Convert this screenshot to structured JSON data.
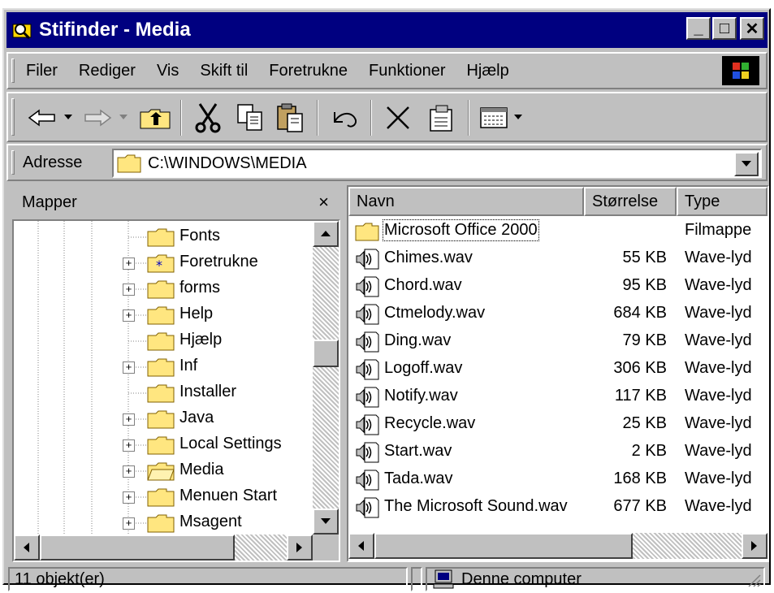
{
  "window": {
    "title": "Stifinder - Media",
    "minimize": "_",
    "maximize": "□",
    "close": "✕"
  },
  "menu": [
    "Filer",
    "Rediger",
    "Vis",
    "Skift til",
    "Foretrukne",
    "Funktioner",
    "Hjælp"
  ],
  "address": {
    "label": "Adresse",
    "value": "C:\\WINDOWS\\MEDIA"
  },
  "left_pane": {
    "title": "Mapper",
    "close": "×",
    "folders": [
      {
        "label": "Fonts",
        "expandable": false
      },
      {
        "label": "Foretrukne",
        "expandable": true
      },
      {
        "label": "forms",
        "expandable": true
      },
      {
        "label": "Help",
        "expandable": true
      },
      {
        "label": "Hjælp",
        "expandable": false
      },
      {
        "label": "Inf",
        "expandable": true
      },
      {
        "label": "Installer",
        "expandable": false
      },
      {
        "label": "Java",
        "expandable": true
      },
      {
        "label": "Local Settings",
        "expandable": true
      },
      {
        "label": "Media",
        "expandable": true
      },
      {
        "label": "Menuen Start",
        "expandable": true
      },
      {
        "label": "Msagent",
        "expandable": true
      }
    ]
  },
  "list": {
    "columns": {
      "name": "Navn",
      "size": "Størrelse",
      "type": "Type"
    },
    "items": [
      {
        "name": "Microsoft Office 2000",
        "size": "",
        "type": "Filmappe",
        "kind": "folder"
      },
      {
        "name": "Chimes.wav",
        "size": "55 KB",
        "type": "Wave-lyd",
        "kind": "wav"
      },
      {
        "name": "Chord.wav",
        "size": "95 KB",
        "type": "Wave-lyd",
        "kind": "wav"
      },
      {
        "name": "Ctmelody.wav",
        "size": "684 KB",
        "type": "Wave-lyd",
        "kind": "wav"
      },
      {
        "name": "Ding.wav",
        "size": "79 KB",
        "type": "Wave-lyd",
        "kind": "wav"
      },
      {
        "name": "Logoff.wav",
        "size": "306 KB",
        "type": "Wave-lyd",
        "kind": "wav"
      },
      {
        "name": "Notify.wav",
        "size": "117 KB",
        "type": "Wave-lyd",
        "kind": "wav"
      },
      {
        "name": "Recycle.wav",
        "size": "25 KB",
        "type": "Wave-lyd",
        "kind": "wav"
      },
      {
        "name": "Start.wav",
        "size": "2 KB",
        "type": "Wave-lyd",
        "kind": "wav"
      },
      {
        "name": "Tada.wav",
        "size": "168 KB",
        "type": "Wave-lyd",
        "kind": "wav"
      },
      {
        "name": "The Microsoft Sound.wav",
        "size": "677 KB",
        "type": "Wave-lyd",
        "kind": "wav"
      }
    ]
  },
  "status": {
    "count": "11 objekt(er)",
    "location": "Denne computer"
  },
  "colors": {
    "titlebar": "#000080",
    "face": "#c0c0c0"
  }
}
